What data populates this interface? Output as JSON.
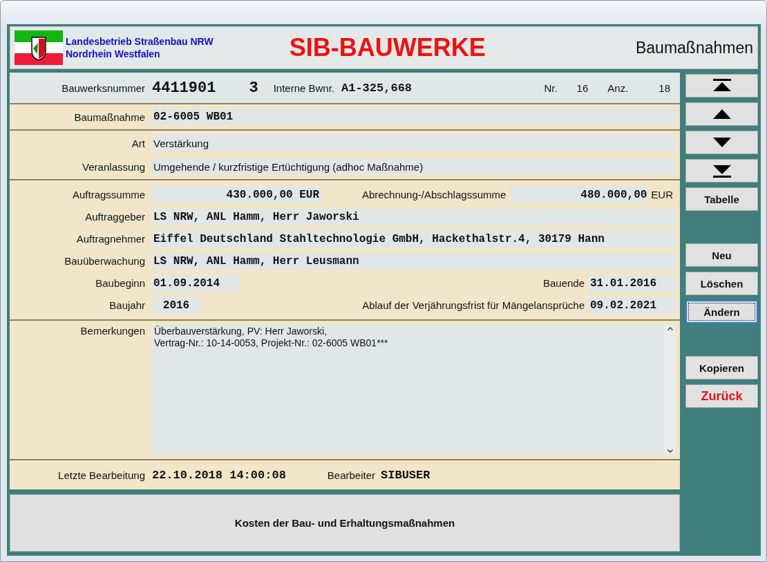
{
  "header": {
    "org_lines": [
      "Landesbetrieb Straßenbau NRW",
      "Nordrhein Westfalen"
    ],
    "app_title": "SIB-BAUWERKE",
    "section": "Baumaßnahmen"
  },
  "record": {
    "number_label": "Bauwerksnummer",
    "number": "4411901",
    "sub_number": "3",
    "internal_label": "Interne Bwnr.",
    "internal": "A1-325,668",
    "nr_label": "Nr.",
    "nr": "16",
    "count_label": "Anz.",
    "count": "18"
  },
  "measure": {
    "label": "Baumaßnahme",
    "value": "02-6005 WB01"
  },
  "type_fields": [
    {
      "label": "Art",
      "value": "Verstärkung"
    },
    {
      "label": "Veranlassung",
      "value": "Umgehende / kurzfristige Ertüchtigung (adhoc Maßnahme)"
    }
  ],
  "contract": {
    "order_sum": {
      "label": "Auftragssumme",
      "value": "430.000,00 EUR"
    },
    "billing_sum": {
      "label": "Abrechnung-/Abschlagssumme",
      "value": "480.000,00",
      "unit": "EUR"
    },
    "parties": [
      {
        "label": "Auftraggeber",
        "value": "LS NRW, ANL Hamm, Herr Jaworski"
      },
      {
        "label": "Auftragnehmer",
        "value": "Eiffel Deutschland Stahltechnologie GmbH, Hackethalstr.4, 30179 Hann"
      },
      {
        "label": "Bauüberwachung",
        "value": "LS NRW, ANL Hamm, Herr Leusmann"
      }
    ],
    "start": {
      "label": "Baubeginn",
      "value": "01.09.2014"
    },
    "end": {
      "label": "Bauende",
      "value": "31.01.2016"
    },
    "year": {
      "label": "Baujahr",
      "value": "2016"
    },
    "warranty": {
      "label": "Ablauf der Verjährungsfrist für Mängelansprüche",
      "value": "09.02.2021"
    }
  },
  "remarks": {
    "label": "Bemerkungen",
    "lines": [
      "Überbauverstärkung, PV: Herr Jaworski,",
      "Vertrag-Nr.: 10-14-0053, Projekt-Nr.: 02-6005 WB01***"
    ]
  },
  "last_edit": {
    "label": "Letzte Bearbeitung",
    "value": "22.10.2018 14:00:08",
    "editor_label": "Bearbeiter",
    "editor": "SIBUSER"
  },
  "costs_button": "Kosten der Bau- und Erhaltungsmaßnahmen",
  "nav_buttons": [
    {
      "kind": "first"
    },
    {
      "kind": "previous"
    },
    {
      "kind": "next"
    },
    {
      "kind": "last"
    }
  ],
  "action_groups": [
    [
      {
        "label": "Tabelle",
        "kind": "normal",
        "focused": false
      }
    ],
    [
      {
        "label": "Neu",
        "kind": "normal",
        "focused": false
      },
      {
        "label": "Löschen",
        "kind": "normal",
        "focused": false
      },
      {
        "label": "Ändern",
        "kind": "normal",
        "focused": true
      }
    ],
    [
      {
        "label": "Kopieren",
        "kind": "normal",
        "focused": false
      },
      {
        "label": "Zurück",
        "kind": "exit",
        "focused": false
      }
    ]
  ]
}
